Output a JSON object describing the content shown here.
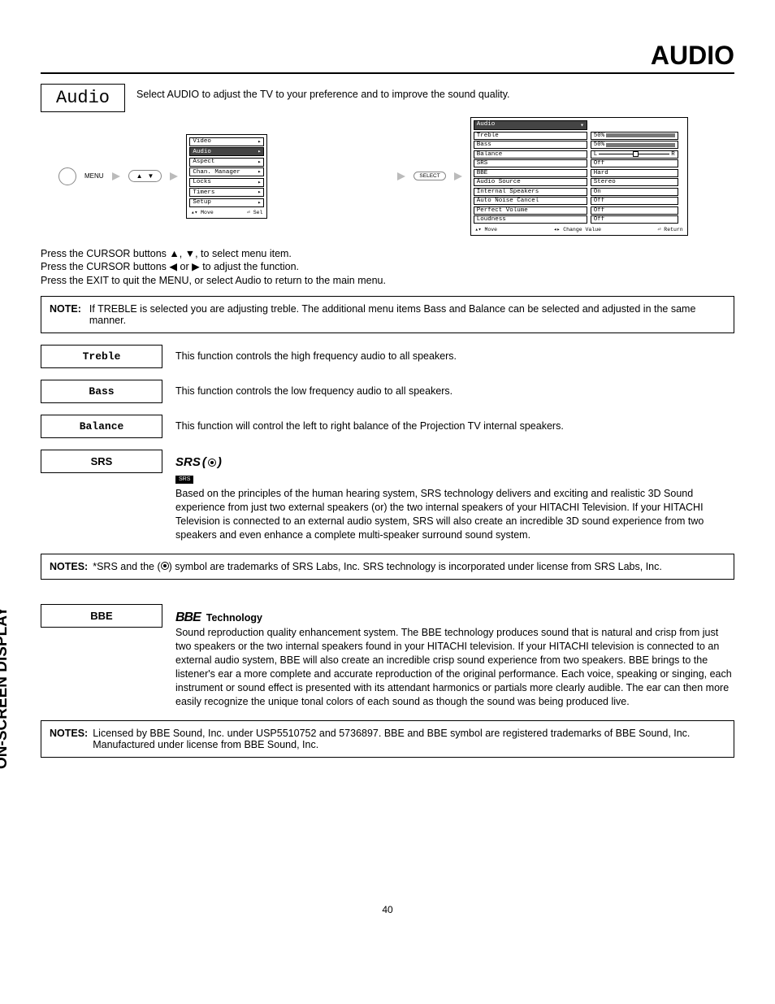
{
  "title": "AUDIO",
  "audio_label": "Audio",
  "intro": "Select AUDIO to adjust the TV to your preference and to improve the sound quality.",
  "menu_label": "MENU",
  "select_label": "SELECT",
  "osd_menu1": {
    "items": [
      "Video",
      "Audio",
      "Aspect",
      "Chan. Manager",
      "Locks",
      "Timers",
      "Setup"
    ],
    "selected": "Audio",
    "foot_left": "Move",
    "foot_right": "Sel"
  },
  "osd_menu2": {
    "header_left": "Audio",
    "rows": [
      {
        "l": "Treble",
        "r": "50%",
        "type": "bar"
      },
      {
        "l": "Bass",
        "r": "50%",
        "type": "bar"
      },
      {
        "l": "Balance",
        "r": "",
        "type": "balance"
      },
      {
        "l": "SRS",
        "r": "Off",
        "type": "text"
      },
      {
        "l": "BBE",
        "r": "Hard",
        "type": "text"
      },
      {
        "l": "Audio Source",
        "r": "Stereo",
        "type": "text"
      },
      {
        "l": "Internal Speakers",
        "r": "On",
        "type": "text"
      },
      {
        "l": "Auto Noise Cancel",
        "r": "Off",
        "type": "text"
      },
      {
        "l": "Perfect Volume",
        "r": "Off",
        "type": "text"
      },
      {
        "l": "Loudness",
        "r": "Off",
        "type": "text"
      }
    ],
    "foot1": "Move",
    "foot2": "Change Value",
    "foot3": "Return",
    "bal_l": "L",
    "bal_r": "R"
  },
  "instructions": {
    "l1a": "Press the CURSOR buttons ",
    "l1b": ", to select menu item.",
    "l2a": "Press the CURSOR buttons  ",
    "l2b": " to adjust the function.",
    "l3": "Press the EXIT to quit the MENU, or select Audio to return to the main menu.",
    "up": "▲",
    "down": "▼",
    "left": "◀",
    "right": "▶",
    "comma": ", ",
    "or": " or "
  },
  "note1": {
    "label": "NOTE:",
    "text": "If TREBLE is selected you are adjusting treble.  The additional menu items Bass and Balance can be selected and adjusted in the same manner."
  },
  "features": {
    "treble": {
      "label": "Treble",
      "desc": "This function controls the high frequency audio to all speakers."
    },
    "bass": {
      "label": "Bass",
      "desc": "This function controls the low frequency audio to all speakers."
    },
    "balance": {
      "label": "Balance",
      "desc": "This function will control the left to right balance of the Projection TV internal speakers."
    },
    "srs": {
      "label": "SRS",
      "logo": "SRS",
      "sub": "SRS",
      "desc": "Based on the principles of the human hearing system, SRS technology delivers and exciting and realistic 3D Sound experience from just two external speakers (or) the two internal speakers of your HITACHI Television.  If your HITACHI Television is connected to an external audio system, SRS will also create an incredible 3D sound experience from two speakers and even enhance a complete multi-speaker surround sound system."
    },
    "bbe": {
      "label": "BBE",
      "logo": "BBE",
      "heading": "Technology",
      "desc": "Sound reproduction quality enhancement system.  The BBE technology produces sound that is natural and crisp from just two speakers or the two internal speakers found in your HITACHI television. If your HITACHI television is connected to an external audio system, BBE will also create an incredible crisp sound experience from two speakers.  BBE brings to the listener's ear a more complete and accurate reproduction of the original performance.  Each voice, speaking or singing, each instrument or sound effect is presented with its attendant harmonics or partials more clearly audible.  The ear can then more easily recognize the unique tonal colors of each sound as though the sound was being produced live."
    }
  },
  "notes2": {
    "label": "NOTES:",
    "pre": "*SRS and the ",
    "post": " symbol are trademarks of SRS Labs, Inc. SRS technology is incorporated under license from SRS Labs, Inc."
  },
  "notes3": {
    "label": "NOTES:",
    "text": "Licensed by BBE Sound, Inc. under USP5510752 and 5736897.  BBE and BBE symbol are registered trademarks of BBE Sound, Inc.  Manufactured under license from BBE Sound, Inc."
  },
  "side_tab": "ON-SCREEN DISPLAY",
  "page_number": "40"
}
